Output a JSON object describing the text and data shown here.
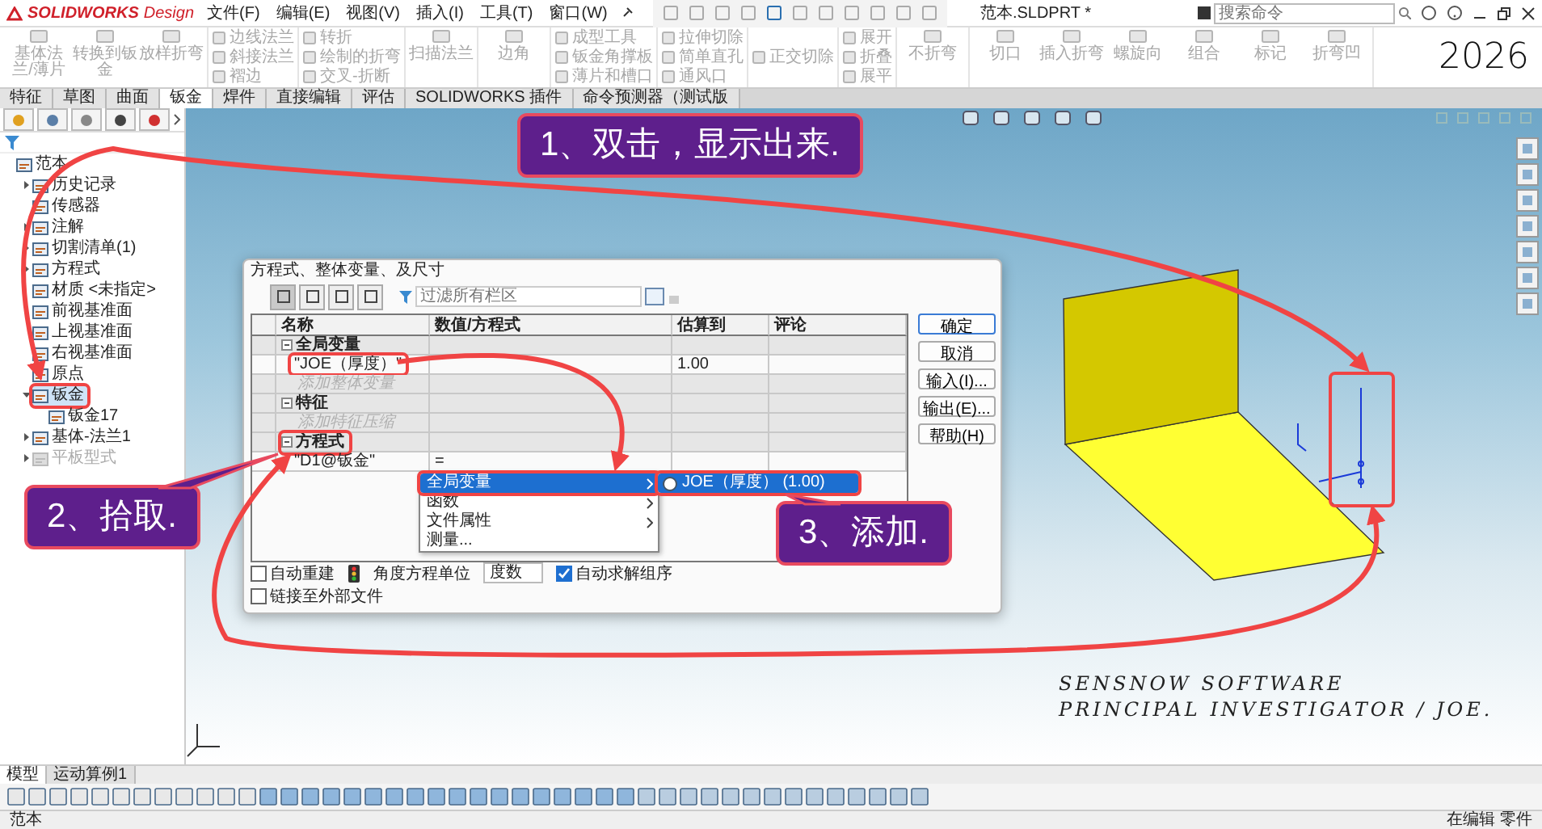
{
  "title_bar": {
    "app_name": "SOLIDWORKS",
    "edition": "Design",
    "menus": [
      "文件(F)",
      "编辑(E)",
      "视图(V)",
      "插入(I)",
      "工具(T)",
      "窗口(W)"
    ],
    "document_title": "范本.SLDPRT *",
    "search": {
      "placeholder": "搜索命令"
    }
  },
  "ribbon": {
    "groups": [
      {
        "kind": "large",
        "items": [
          {
            "label": "基体法兰/薄片",
            "disabled": true
          },
          {
            "label": "转换到钣金",
            "disabled": true
          },
          {
            "label": "放样折弯",
            "disabled": true
          }
        ]
      },
      {
        "kind": "small",
        "items": [
          {
            "label": "边线法兰",
            "disabled": true
          },
          {
            "label": "斜接法兰",
            "disabled": true
          },
          {
            "label": "褶边",
            "disabled": true
          }
        ]
      },
      {
        "kind": "small",
        "items": [
          {
            "label": "转折",
            "disabled": true
          },
          {
            "label": "绘制的折弯",
            "disabled": true
          },
          {
            "label": "交叉-折断",
            "disabled": true
          }
        ]
      },
      {
        "kind": "large",
        "items": [
          {
            "label": "扫描法兰",
            "disabled": true
          }
        ]
      },
      {
        "kind": "large",
        "items": [
          {
            "label": "边角",
            "disabled": true
          }
        ]
      },
      {
        "kind": "small",
        "items": [
          {
            "label": "成型工具",
            "disabled": true
          },
          {
            "label": "钣金角撑板",
            "disabled": true
          },
          {
            "label": "薄片和槽口",
            "disabled": true
          }
        ]
      },
      {
        "kind": "small",
        "items": [
          {
            "label": "拉伸切除",
            "disabled": true
          },
          {
            "label": "简单直孔",
            "disabled": true
          },
          {
            "label": "通风口",
            "disabled": true
          }
        ]
      },
      {
        "kind": "small",
        "items": [
          {
            "label": "正交切除",
            "disabled": true
          }
        ]
      },
      {
        "kind": "small",
        "items": [
          {
            "label": "展开",
            "disabled": true
          },
          {
            "label": "折叠",
            "disabled": true
          },
          {
            "label": "展平",
            "disabled": true
          }
        ]
      },
      {
        "kind": "large",
        "items": [
          {
            "label": "不折弯",
            "disabled": true
          }
        ]
      },
      {
        "kind": "large",
        "items": [
          {
            "label": "切口",
            "disabled": true
          },
          {
            "label": "插入折弯",
            "disabled": true
          },
          {
            "label": "螺旋向",
            "disabled": true
          },
          {
            "label": "组合",
            "disabled": true
          },
          {
            "label": "标记",
            "disabled": true
          },
          {
            "label": "折弯凹",
            "disabled": true
          }
        ]
      }
    ]
  },
  "year_mark": "2026",
  "ribbon_tabs": [
    {
      "label": "特征",
      "selected": false
    },
    {
      "label": "草图",
      "selected": false
    },
    {
      "label": "曲面",
      "selected": false
    },
    {
      "label": "钣金",
      "selected": true
    },
    {
      "label": "焊件",
      "selected": false
    },
    {
      "label": "直接编辑",
      "selected": false
    },
    {
      "label": "评估",
      "selected": false
    },
    {
      "label": "SOLIDWORKS 插件",
      "selected": false
    },
    {
      "label": "命令预测器（测试版",
      "selected": false
    }
  ],
  "feature_tree": {
    "items": [
      {
        "label": "范本",
        "expandable": false,
        "selected": false,
        "disabled": false,
        "highlighted": false,
        "children": [
          {
            "label": "历史记录",
            "expandable": true,
            "expanded": false,
            "selected": false,
            "disabled": false,
            "highlighted": false
          },
          {
            "label": "传感器",
            "expandable": false,
            "selected": false,
            "disabled": false,
            "highlighted": false
          },
          {
            "label": "注解",
            "expandable": true,
            "expanded": false,
            "selected": false,
            "disabled": false,
            "highlighted": false
          },
          {
            "label": "切割清单(1)",
            "expandable": true,
            "expanded": false,
            "selected": false,
            "disabled": false,
            "highlighted": false
          },
          {
            "label": "方程式",
            "expandable": true,
            "expanded": false,
            "selected": false,
            "disabled": false,
            "highlighted": false
          },
          {
            "label": "材质 <未指定>",
            "expandable": false,
            "selected": false,
            "disabled": false,
            "highlighted": false
          },
          {
            "label": "前视基准面",
            "expandable": false,
            "selected": false,
            "disabled": false,
            "highlighted": false
          },
          {
            "label": "上视基准面",
            "expandable": false,
            "selected": false,
            "disabled": false,
            "highlighted": false
          },
          {
            "label": "右视基准面",
            "expandable": false,
            "selected": false,
            "disabled": false,
            "highlighted": false
          },
          {
            "label": "原点",
            "expandable": false,
            "selected": false,
            "disabled": false,
            "highlighted": false
          },
          {
            "label": "钣金",
            "expandable": true,
            "expanded": true,
            "selected": true,
            "disabled": false,
            "highlighted": true,
            "children": [
              {
                "label": "钣金17",
                "expandable": false,
                "selected": false,
                "disabled": false,
                "highlighted": false
              }
            ]
          },
          {
            "label": "基体-法兰1",
            "expandable": true,
            "expanded": false,
            "selected": false,
            "disabled": false,
            "highlighted": false
          },
          {
            "label": "平板型式",
            "expandable": true,
            "expanded": false,
            "selected": false,
            "disabled": true,
            "highlighted": false
          }
        ]
      }
    ]
  },
  "dialog": {
    "title": "方程式、整体变量、及尺寸",
    "filter": {
      "placeholder": "过滤所有栏区"
    },
    "columns": [
      "名称",
      "数值/方程式",
      "估算到",
      "评论"
    ],
    "rows": [
      {
        "kind": "section",
        "name": "全局变量",
        "highlighted": false
      },
      {
        "kind": "entry",
        "name": "\"JOE（厚度）\"",
        "value": "",
        "result": "1.00",
        "highlighted": true
      },
      {
        "kind": "hint",
        "name": "添加整体变量",
        "highlighted": false
      },
      {
        "kind": "section",
        "name": "特征",
        "highlighted": false
      },
      {
        "kind": "hint",
        "name": "添加特征压缩",
        "highlighted": false
      },
      {
        "kind": "section",
        "name": "方程式",
        "highlighted": true
      },
      {
        "kind": "entry",
        "name": "\"D1@钣金\"",
        "value": "=",
        "result": "",
        "highlighted": false
      }
    ],
    "menu": [
      {
        "label": "全局变量",
        "selected": true,
        "submenu": true
      },
      {
        "label": "函数",
        "selected": false,
        "submenu": true
      },
      {
        "label": "文件属性",
        "selected": false,
        "submenu": true
      },
      {
        "label": "测量...",
        "selected": false,
        "submenu": false
      }
    ],
    "submenu": [
      {
        "label": "JOE（厚度） (1.00)",
        "selected": true
      }
    ],
    "buttons": [
      "确定",
      "取消",
      "输入(I)...",
      "输出(E)...",
      "帮助(H)"
    ],
    "options": [
      {
        "label": "自动重建",
        "checked": false
      },
      {
        "label": "链接至外部文件",
        "checked": false
      }
    ],
    "angle_unit": {
      "label": "角度方程单位",
      "value": "度数"
    },
    "auto_order": {
      "label": "自动求解组序",
      "checked": true
    }
  },
  "callouts": [
    "1、双击，显示出来.",
    "2、拾取.",
    "3、添加."
  ],
  "signature": [
    "SENSNOW SOFTWARE",
    "PRINCIPAL INVESTIGATOR / JOE."
  ],
  "bottom_tabs": [
    {
      "label": "模型",
      "selected": true
    },
    {
      "label": "运动算例1",
      "selected": false
    }
  ],
  "status_bar": {
    "left": "范本",
    "right": "在编辑 零件"
  }
}
